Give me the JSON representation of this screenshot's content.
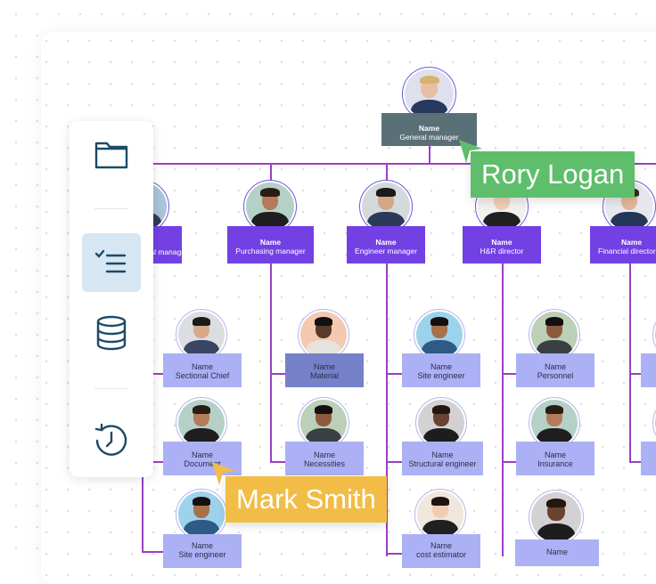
{
  "colors": {
    "connector": "#9b3fc4",
    "top_card": "#5a7077",
    "manager_card": "#7340e3",
    "staff_card": "#abb1f4",
    "staff_card_highlight": "#7581c9",
    "cursor_green": "#5fbe6b",
    "cursor_yellow": "#f2bd47",
    "sidebar_active": "#d6e6f3",
    "icon": "#1d4a68"
  },
  "sidebar": {
    "items": [
      {
        "icon": "folder-icon",
        "active": false
      },
      {
        "icon": "checklist-icon",
        "active": true
      },
      {
        "icon": "database-icon",
        "active": false
      },
      {
        "icon": "history-icon",
        "active": false
      }
    ]
  },
  "org": {
    "root": {
      "name": "Name",
      "role": "General manager"
    },
    "managers": [
      {
        "name": "Name",
        "role": "Sectional manager"
      },
      {
        "name": "Name",
        "role": "Purchasing manager"
      },
      {
        "name": "Name",
        "role": "Engineer manager"
      },
      {
        "name": "Name",
        "role": "H&R director"
      },
      {
        "name": "Name",
        "role": "Financial director"
      }
    ],
    "staff": [
      {
        "name": "Name",
        "role": "Sectional Chief"
      },
      {
        "name": "Name",
        "role": "Material"
      },
      {
        "name": "Name",
        "role": "Site engineer"
      },
      {
        "name": "Name",
        "role": "Personnel"
      },
      {
        "name": "Name",
        "role": "Document"
      },
      {
        "name": "Name",
        "role": "Necessities"
      },
      {
        "name": "Name",
        "role": "Structural engineer"
      },
      {
        "name": "Name",
        "role": "Insurance"
      },
      {
        "name": "Name",
        "role": "Site engineer"
      },
      {
        "name": "Name",
        "role": "cost estimator"
      },
      {
        "name": "Name",
        "role": ""
      }
    ]
  },
  "collaborators": [
    {
      "name": "Rory Logan",
      "color": "green"
    },
    {
      "name": "Mark Smith",
      "color": "yellow"
    }
  ]
}
